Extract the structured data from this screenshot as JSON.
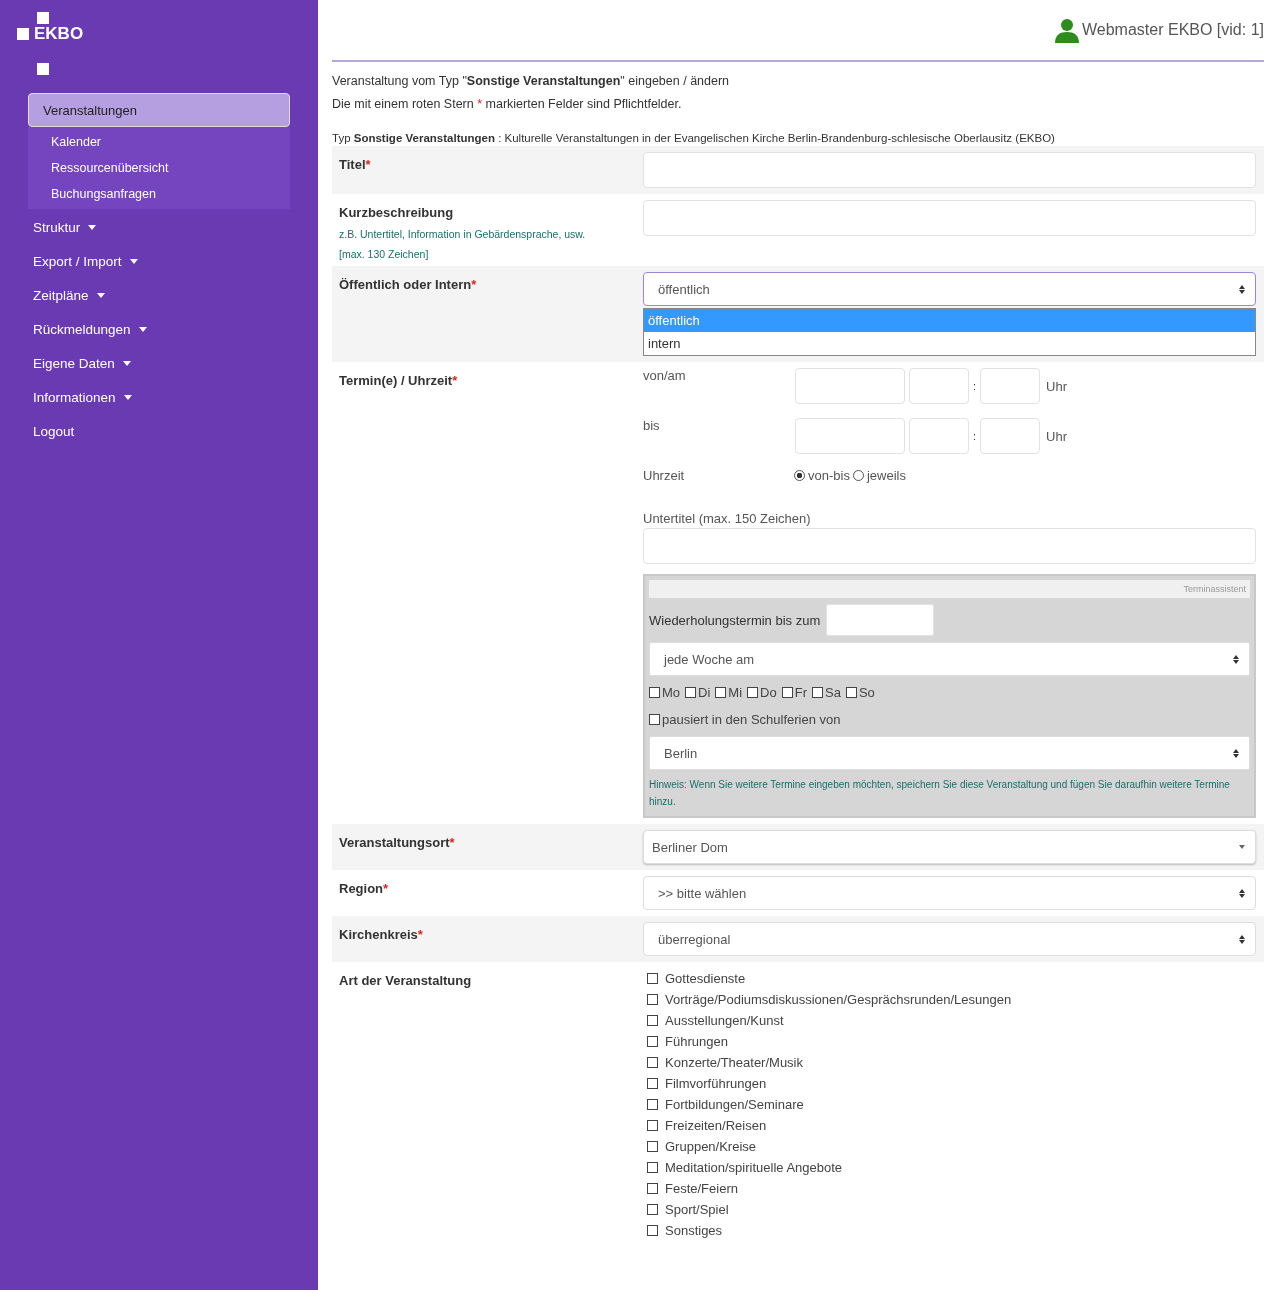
{
  "sidebar": {
    "logo": "EKBO",
    "items": [
      {
        "label": "Veranstaltungen",
        "selected": true,
        "dropdown": false,
        "children": [
          {
            "label": "Kalender"
          },
          {
            "label": "Ressourcenübersicht"
          },
          {
            "label": "Buchungsanfragen"
          }
        ]
      },
      {
        "label": "Struktur",
        "selected": false,
        "dropdown": true
      },
      {
        "label": "Export / Import",
        "selected": false,
        "dropdown": true
      },
      {
        "label": "Zeitpläne",
        "selected": false,
        "dropdown": true
      },
      {
        "label": "Rückmeldungen",
        "selected": false,
        "dropdown": true
      },
      {
        "label": "Eigene Daten",
        "selected": false,
        "dropdown": true
      },
      {
        "label": "Informationen",
        "selected": false,
        "dropdown": true
      },
      {
        "label": "Logout",
        "selected": false,
        "dropdown": false
      }
    ]
  },
  "header": {
    "user": "Webmaster EKBO [vid: 1]"
  },
  "intro": {
    "line_1": "Veranstaltung vom Typ \"**Sonstige Veranstaltungen**\" eingeben / ändern",
    "line_2": {
      "before": "Die mit einem roten Stern",
      "star": "*",
      "after": "markierten Felder sind Pflichtfelder."
    },
    "type_line": "Typ **Sonstige Veranstaltungen** : Kulturelle Veranstaltungen in der Evangelischen Kirche Berlin-Brandenburg-schlesische Oberlausitz (EKBO)"
  },
  "form": [
    {
      "kind": "text",
      "label": "Titel",
      "mark": "*"
    },
    {
      "kind": "text",
      "label": "Kurzbeschreibung",
      "hints": [
        "z.B. Untertitel, Information in Gebärdensprache, usw.",
        "[max. 130 Zeichen]"
      ]
    },
    {
      "kind": "open-select",
      "label": "Öffentlich oder Intern",
      "mark": "*",
      "value": "öffentlich",
      "options": [
        {
          "label": "öffentlich",
          "selected": true
        },
        {
          "label": "intern",
          "selected": false
        }
      ]
    },
    {
      "kind": "termin",
      "label": "Termin(e) / Uhrzeit",
      "mark": "*",
      "dates": [
        {
          "label": "von/am",
          "separator": ":",
          "unit": "Uhr"
        },
        {
          "label": "bis",
          "separator": ":",
          "unit": "Uhr"
        }
      ],
      "time_mode": {
        "label": "Uhrzeit",
        "options": [
          {
            "label": "von-bis",
            "selected": true
          },
          {
            "label": "jeweils",
            "selected": false
          }
        ]
      },
      "subtitle_label": "Untertitel (max. 150 Zeichen)",
      "assistant": {
        "title": "Terminassistent",
        "repeat_label": "Wiederholungstermin bis zum",
        "interval": "jede Woche am",
        "days": [
          {
            "label": "Mo",
            "checked": false
          },
          {
            "label": "Di",
            "checked": false
          },
          {
            "label": "Mi",
            "checked": false
          },
          {
            "label": "Do",
            "checked": false
          },
          {
            "label": "Fr",
            "checked": false
          },
          {
            "label": "Sa",
            "checked": false
          },
          {
            "label": "So",
            "checked": false
          }
        ],
        "pause": {
          "label": "pausiert in den Schulferien von",
          "checked": false
        },
        "state": "Berlin",
        "hint": "Hinweis: Wenn Sie weitere Termine eingeben möchten, speichern Sie diese Veranstaltung und fügen Sie daraufhin weitere Termine hinzu."
      }
    },
    {
      "kind": "combo",
      "label": "Veranstaltungsort",
      "mark": "*",
      "value": "Berliner Dom"
    },
    {
      "kind": "select",
      "label": "Region",
      "mark": "*",
      "value": ">> bitte wählen"
    },
    {
      "kind": "select",
      "label": "Kirchenkreis",
      "mark": "*",
      "value": "überregional"
    },
    {
      "kind": "checklist",
      "label": "Art der Veranstaltung",
      "options": [
        {
          "label": "Gottesdienste",
          "checked": false
        },
        {
          "label": "Vorträge/Podiumsdiskussionen/Gesprächsrunden/Lesungen",
          "checked": false
        },
        {
          "label": "Ausstellungen/Kunst",
          "checked": false
        },
        {
          "label": "Führungen",
          "checked": false
        },
        {
          "label": "Konzerte/Theater/Musik",
          "checked": false
        },
        {
          "label": "Filmvorführungen",
          "checked": false
        },
        {
          "label": "Fortbildungen/Seminare",
          "checked": false
        },
        {
          "label": "Freizeiten/Reisen",
          "checked": false
        },
        {
          "label": "Gruppen/Kreise",
          "checked": false
        },
        {
          "label": "Meditation/spirituelle Angebote",
          "checked": false
        },
        {
          "label": "Feste/Feiern",
          "checked": false
        },
        {
          "label": "Sport/Spiel",
          "checked": false
        },
        {
          "label": "Sonstiges",
          "checked": false
        }
      ]
    }
  ]
}
